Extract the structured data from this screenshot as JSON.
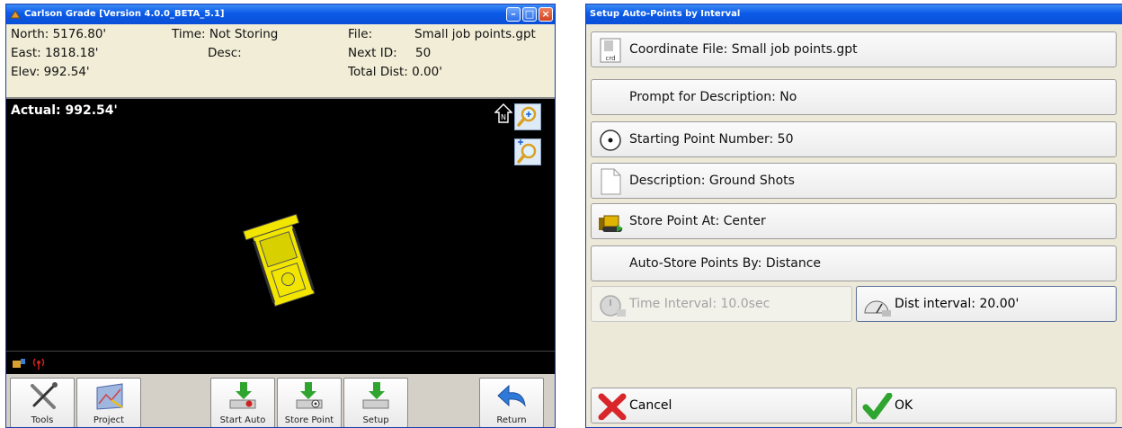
{
  "left_window": {
    "title": "Carlson Grade [Version 4.0.0_BETA_5.1]",
    "info": {
      "north": "North: 5176.80'",
      "east": "East:  1818.18'",
      "elev": "Elev:  992.54'",
      "time": "Time: Not Storing",
      "desc": "Desc:",
      "file_label": "File:",
      "file_value": "Small job points.gpt",
      "next_id_label": "Next ID:",
      "next_id_value": "50",
      "total_dist": "Total Dist: 0.00'"
    },
    "map": {
      "actual": "Actual: 992.54'",
      "north_marker": "N"
    },
    "toolbar": {
      "tools": "Tools",
      "project": "Project",
      "start_auto": "Start Auto",
      "store_point": "Store Point",
      "setup": "Setup",
      "return": "Return"
    }
  },
  "right_window": {
    "title": "Setup Auto-Points by Interval",
    "rows": {
      "coordinate_file": "Coordinate File: Small job points.gpt",
      "coordinate_file_icon_text": "crd",
      "prompt_description": "Prompt for Description: No",
      "starting_point": "Starting Point Number: 50",
      "description": "Description: Ground Shots",
      "store_point_at": "Store Point At: Center",
      "auto_store_by": "Auto-Store Points By: Distance"
    },
    "time_interval": "Time Interval: 10.0sec",
    "dist_interval": "Dist interval: 20.00'",
    "cancel": "Cancel",
    "ok": "OK"
  },
  "colors": {
    "titlebar": "#0b5be8",
    "info_panel": "#f1edd6",
    "map_background": "#000000",
    "machine_yellow": "#f2e600",
    "ok_green": "#2fa52f",
    "cancel_red": "#d8262b"
  }
}
